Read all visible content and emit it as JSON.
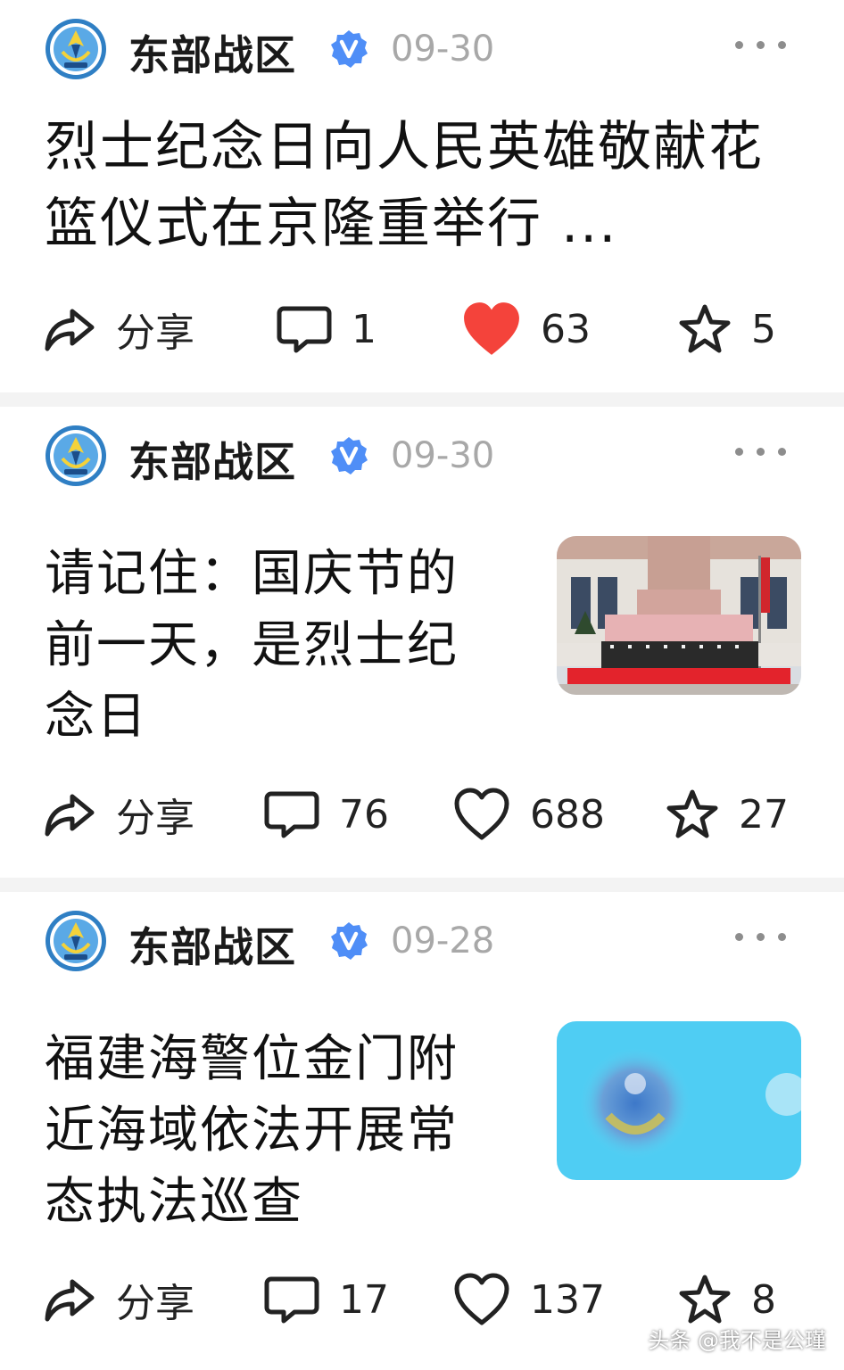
{
  "accent_like_color": "#f4433b",
  "verified_color": "#4f8ef7",
  "posts": [
    {
      "author": "东部战区",
      "date": "09-30",
      "title": "烈士纪念日向人民英雄敬献花篮仪式在京隆重举行 ...",
      "share_label": "分享",
      "comments": "1",
      "likes": "63",
      "liked": true,
      "favorites": "5",
      "thumbnail": null
    },
    {
      "author": "东部战区",
      "date": "09-30",
      "title": "请记住：国庆节的前一天，是烈士纪念日",
      "share_label": "分享",
      "comments": "76",
      "likes": "688",
      "liked": false,
      "favorites": "27",
      "thumbnail": "monument-ceremony-photo"
    },
    {
      "author": "东部战区",
      "date": "09-28",
      "title": "福建海警位金门附近海域依法开展常态执法巡查",
      "share_label": "分享",
      "comments": "17",
      "likes": "137",
      "liked": false,
      "favorites": "8",
      "thumbnail": "coast-guard-emblem-image"
    }
  ],
  "watermark": "头条 @我不是公瑾"
}
